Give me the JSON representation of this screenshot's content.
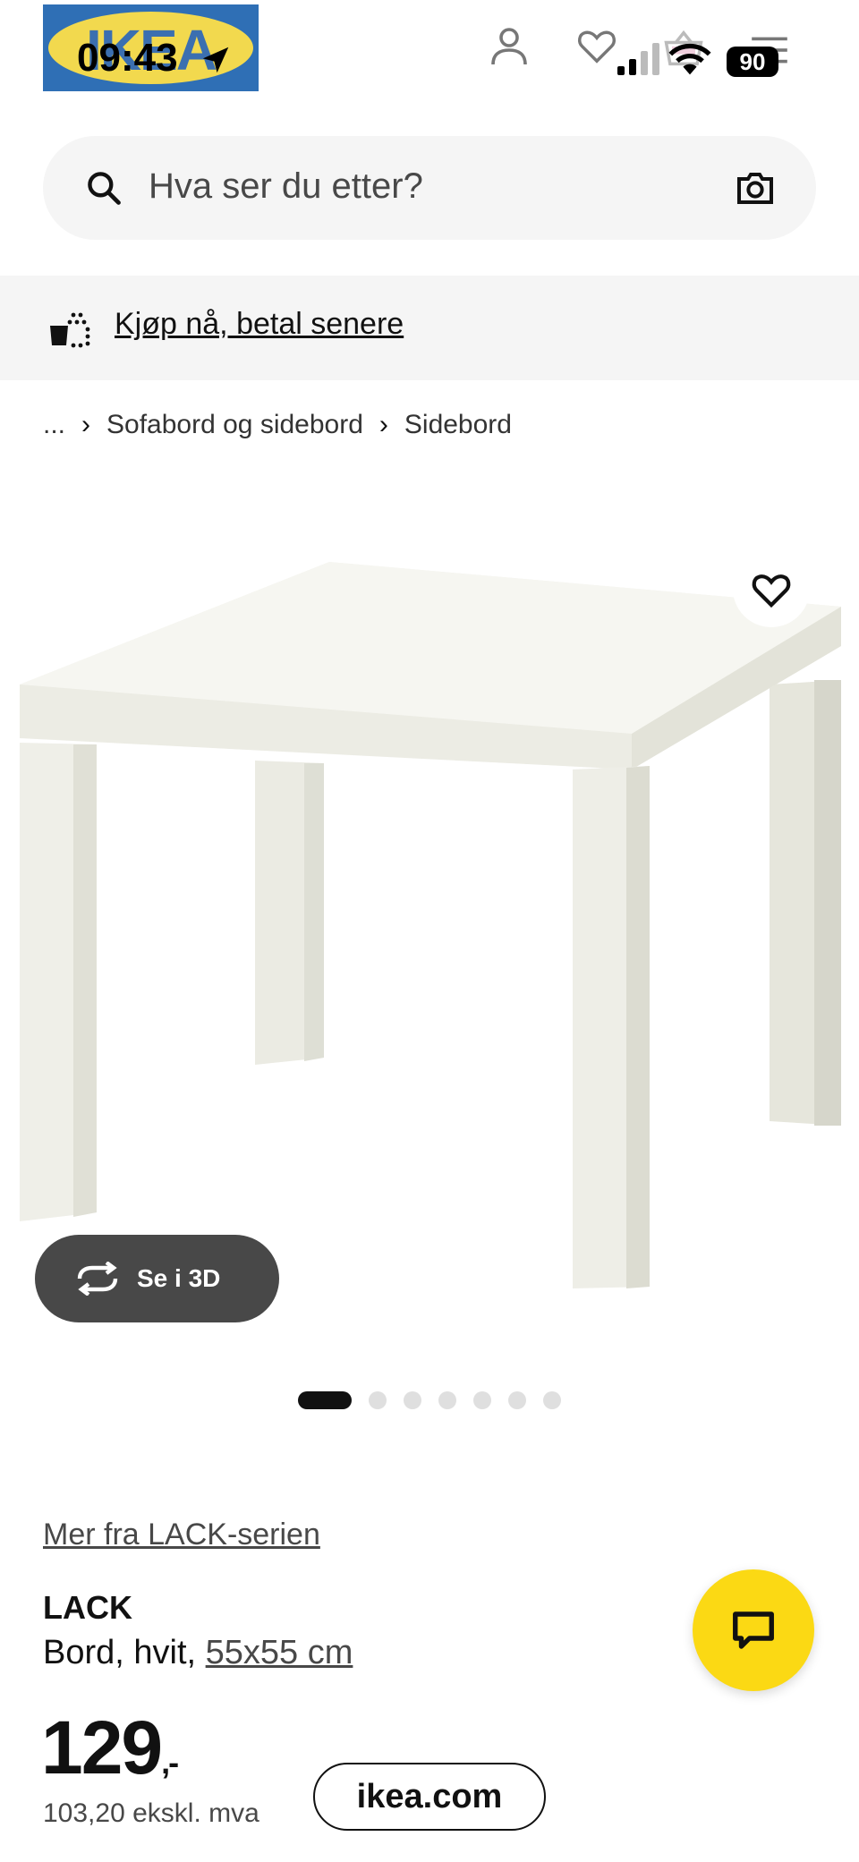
{
  "status_bar": {
    "time": "09:43",
    "battery": "90"
  },
  "header": {
    "logo_text": "IKEA",
    "icons": [
      "profile-icon",
      "heart-icon",
      "basket-icon",
      "menu-icon"
    ]
  },
  "search": {
    "placeholder": "Hva ser du etter?"
  },
  "promo": {
    "text": "Kjøp nå, betal senere"
  },
  "breadcrumb": {
    "ellipsis": "...",
    "items": [
      "Sofabord og sidebord",
      "Sidebord"
    ]
  },
  "product_image": {
    "view_3d_label": "Se i 3D",
    "dots_total": 7,
    "active_dot": 1
  },
  "product": {
    "series_link": "Mer fra LACK-serien",
    "name": "LACK",
    "description": "Bord, hvit, ",
    "size_link": "55x55 cm",
    "price": "129",
    "price_suffix": ",-",
    "price_excl_vat": "103,20 ekskl. mva"
  },
  "browser": {
    "url": "ikea.com"
  },
  "colors": {
    "brand_yellow": "#fbd914",
    "brand_blue": "#2f6fb5",
    "dark_button": "#484848"
  }
}
